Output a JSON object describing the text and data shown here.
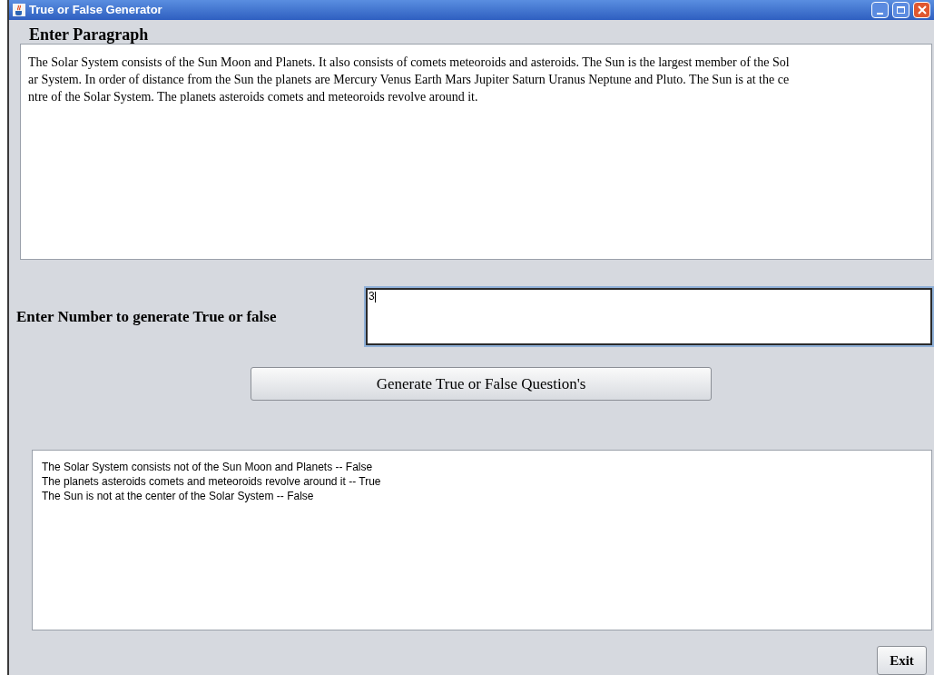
{
  "window": {
    "title": "True or False Generator"
  },
  "paragraph": {
    "label": "Enter Paragraph",
    "lines": [
      "The Solar System consists of the Sun Moon and Planets. It also consists of comets meteoroids and asteroids. The Sun is the largest member of the Sol",
      "ar System. In order of distance from the Sun the planets are Mercury Venus Earth Mars Jupiter Saturn Uranus Neptune and Pluto. The Sun is at the ce",
      "ntre of the Solar System. The planets asteroids comets and meteoroids revolve around it."
    ]
  },
  "number": {
    "label": "Enter Number to generate True or false",
    "value": "3"
  },
  "generate_button": "Generate True or False Question's",
  "results": [
    "The Solar System consists not of the Sun Moon and Planets -- False",
    "The planets asteroids comets and meteoroids revolve around it -- True",
    "The Sun is not at the center of the Solar System -- False"
  ],
  "exit_button": "Exit"
}
